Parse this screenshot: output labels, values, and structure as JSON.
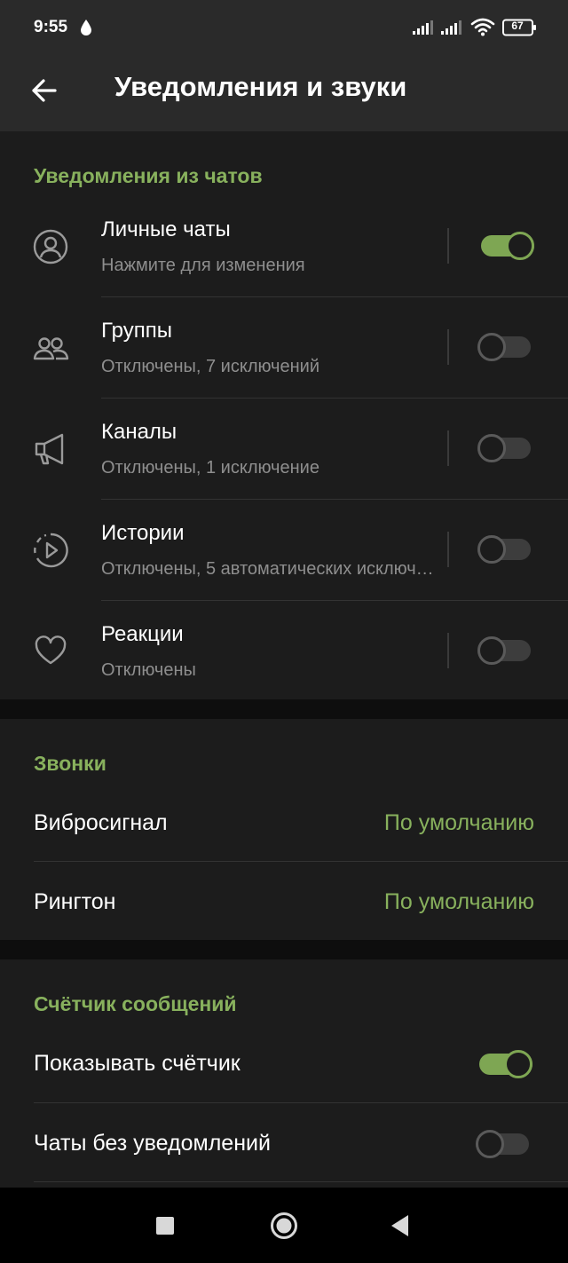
{
  "status_bar": {
    "time": "9:55",
    "battery": "67",
    "icons": [
      "drop-icon",
      "signal-icon",
      "signal-icon",
      "wifi-icon",
      "battery-icon"
    ]
  },
  "app_bar": {
    "title": "Уведомления и звуки",
    "back_icon": "arrow-left-icon"
  },
  "chat_notifications": {
    "header": "Уведомления из чатов",
    "items": [
      {
        "title": "Личные чаты",
        "subtitle": "Нажмите для изменения",
        "icon": "person-icon",
        "enabled": true
      },
      {
        "title": "Группы",
        "subtitle": "Отключены, 7 исключений",
        "icon": "group-icon",
        "enabled": false
      },
      {
        "title": "Каналы",
        "subtitle": "Отключены, 1 исключение",
        "icon": "megaphone-icon",
        "enabled": false
      },
      {
        "title": "Истории",
        "subtitle": "Отключены, 5 автоматических исключений",
        "icon": "story-icon",
        "enabled": false
      },
      {
        "title": "Реакции",
        "subtitle": "Отключены",
        "icon": "heart-icon",
        "enabled": false
      }
    ]
  },
  "calls": {
    "header": "Звонки",
    "items": [
      {
        "title": "Вибросигнал",
        "value": "По умолчанию"
      },
      {
        "title": "Рингтон",
        "value": "По умолчанию"
      }
    ]
  },
  "message_counter": {
    "header": "Счётчик сообщений",
    "items": [
      {
        "title": "Показывать счётчик",
        "enabled": true
      },
      {
        "title": "Чаты без уведомлений",
        "enabled": false
      }
    ]
  },
  "colors": {
    "accent": "#88b15d",
    "toggle_on": "#7ea653",
    "background": "#1c1c1c",
    "subtitle": "#8e8e8e"
  }
}
